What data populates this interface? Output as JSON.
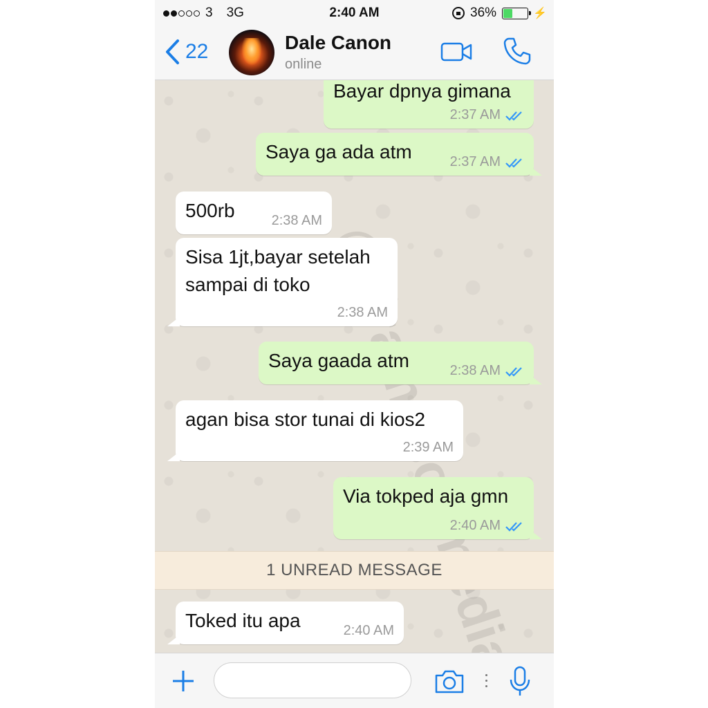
{
  "status_bar": {
    "carrier": "3",
    "network": "3G",
    "time": "2:40 AM",
    "battery": "36%",
    "battery_level": 0.36,
    "signal_bars": 2
  },
  "header": {
    "back_count": "22",
    "contact_name": "Dale Canon",
    "contact_status": "online"
  },
  "messages": [
    {
      "direction": "out",
      "text": "Bayar dpnya gimana",
      "time": "2:37 AM",
      "status": "read"
    },
    {
      "direction": "out",
      "text": "Saya ga ada atm",
      "time": "2:37 AM",
      "status": "read"
    },
    {
      "direction": "in",
      "text": "500rb",
      "time": "2:38 AM"
    },
    {
      "direction": "in",
      "text": "Sisa 1jt,bayar setelah\nsampai di toko",
      "time": "2:38 AM"
    },
    {
      "direction": "out",
      "text": "Saya gaada atm",
      "time": "2:38 AM",
      "status": "read"
    },
    {
      "direction": "in",
      "text": "agan bisa stor tunai di kios2",
      "time": "2:39 AM"
    },
    {
      "direction": "out",
      "text": "Via tokped aja gmn",
      "time": "2:40 AM",
      "status": "read"
    },
    {
      "direction": "in",
      "text": "Toked itu apa",
      "time": "2:40 AM"
    }
  ],
  "unread_banner": "1 UNREAD MESSAGE",
  "watermark": "@dramasosmedia",
  "input": {
    "placeholder": ""
  },
  "colors": {
    "accent": "#1b7ee6",
    "outgoing_bubble": "#dcf8c6",
    "incoming_bubble": "#ffffff",
    "read_ticks": "#3497f9",
    "chat_background": "#e6e1d8"
  }
}
